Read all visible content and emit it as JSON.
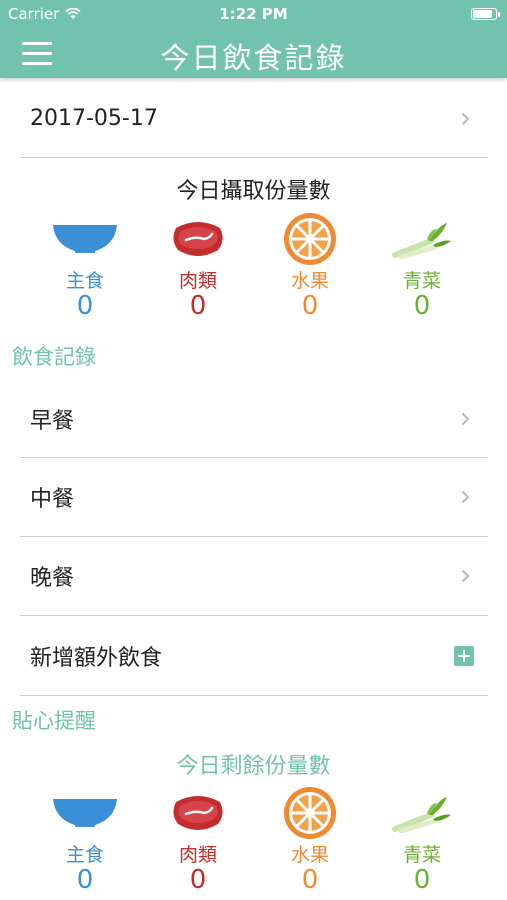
{
  "status_bar": {
    "carrier": "Carrier",
    "time": "1:22 PM"
  },
  "nav": {
    "title": "今日飲食記錄",
    "menu_icon": "hamburger-menu-icon"
  },
  "date_row": {
    "date": "2017-05-17"
  },
  "intake": {
    "title": "今日攝取份量數",
    "items": [
      {
        "label": "主食",
        "count": "0",
        "icon": "rice-bowl-icon",
        "color": "#3a8fd6"
      },
      {
        "label": "肉類",
        "count": "0",
        "icon": "meat-icon",
        "color": "#c42d2d"
      },
      {
        "label": "水果",
        "count": "0",
        "icon": "orange-slice-icon",
        "color": "#f08a32"
      },
      {
        "label": "青菜",
        "count": "0",
        "icon": "vegetable-icon",
        "color": "#6cb033"
      }
    ]
  },
  "diet_log": {
    "heading": "飲食記錄",
    "items": [
      {
        "label": "早餐"
      },
      {
        "label": "中餐"
      },
      {
        "label": "晚餐"
      }
    ],
    "add_extra": "新增額外飲食"
  },
  "tips": {
    "heading": "貼心提醒",
    "remaining_title": "今日剩餘份量數",
    "items": [
      {
        "label": "主食",
        "count": "0",
        "icon": "rice-bowl-icon",
        "color": "#3a8fd6"
      },
      {
        "label": "肉類",
        "count": "0",
        "icon": "meat-icon",
        "color": "#c42d2d"
      },
      {
        "label": "水果",
        "count": "0",
        "icon": "orange-slice-icon",
        "color": "#f08a32"
      },
      {
        "label": "青菜",
        "count": "0",
        "icon": "vegetable-icon",
        "color": "#6cb033"
      }
    ]
  },
  "colors": {
    "accent": "#72c3ad"
  }
}
